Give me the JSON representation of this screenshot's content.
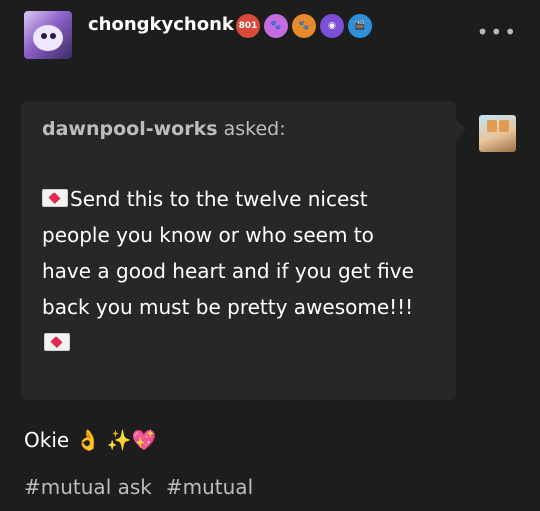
{
  "post": {
    "author": "chongkychonk",
    "more_label": "•••",
    "badges": [
      {
        "name": "stamp-badge-801",
        "label": "801",
        "color": "#d94a3a"
      },
      {
        "name": "paw-badge-pink",
        "label": "🐾",
        "color": "#c46be0"
      },
      {
        "name": "paw-badge-orange",
        "label": "🐾",
        "color": "#e78a2c"
      },
      {
        "name": "disco-badge",
        "label": "◉",
        "color": "#7b4fd6"
      },
      {
        "name": "clapper-badge",
        "label": "🎬",
        "color": "#2f8fd8"
      }
    ]
  },
  "ask": {
    "asker": "dawnpool-works",
    "asked_suffix": " asked:",
    "text": "Send this to the twelve nicest people you know or who seem to have a good heart and if you get five back you must be pretty awesome!!!"
  },
  "answer": {
    "text": "Okie 👌 ✨💖"
  },
  "tags": [
    "#mutual ask",
    "#mutual"
  ]
}
